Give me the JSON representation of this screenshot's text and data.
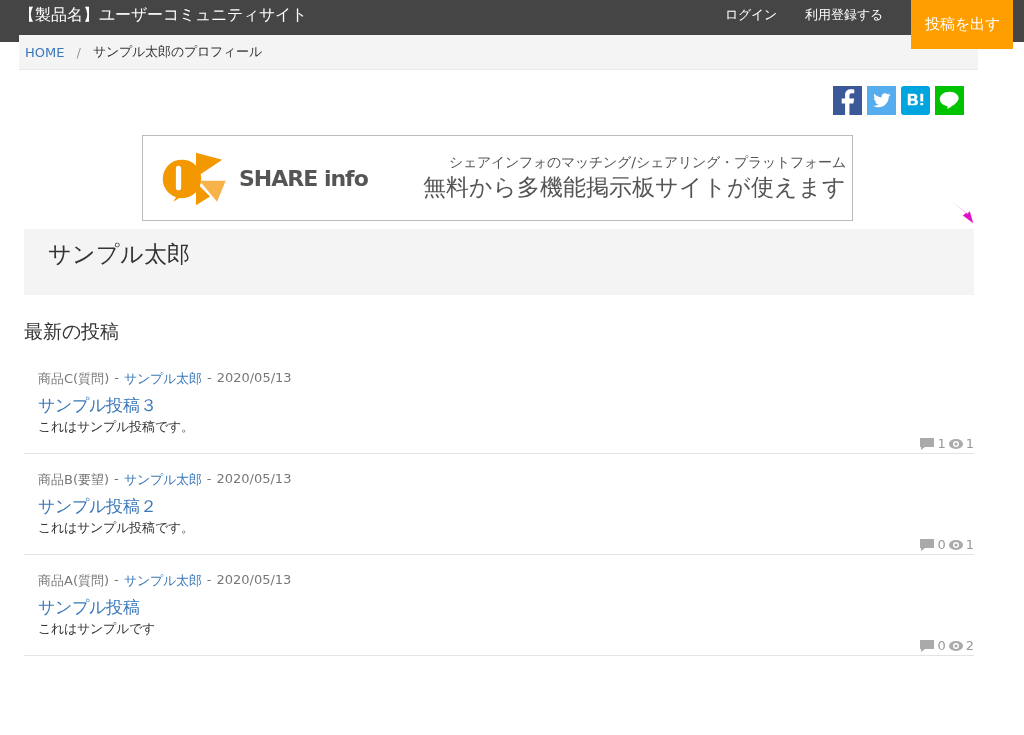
{
  "navbar": {
    "brand": "【製品名】ユーザーコミュニティサイト",
    "links": [
      "ログイン",
      "利用登録する"
    ],
    "post_button": "投稿を出す"
  },
  "breadcrumb": [
    {
      "label": "HOME",
      "kind": "link"
    },
    {
      "label": "/",
      "kind": "separator"
    },
    {
      "label": "サンプル太郎のプロフィール",
      "kind": "current"
    }
  ],
  "banner": {
    "logo_text": "SHARE info",
    "tagline": "シェアインフォのマッチング/シェアリング・プラットフォーム",
    "headline": "無料から多機能掲示板サイトが使えます"
  },
  "profile": {
    "name": "サンプル太郎"
  },
  "section_title": "最新の投稿",
  "posts": [
    {
      "meta": [
        {
          "text": "商品C(質問)",
          "kind": "category"
        },
        {
          "text": "-",
          "kind": "separator"
        },
        {
          "text": "サンプル太郎",
          "kind": "author"
        },
        {
          "text": "-",
          "kind": "separator"
        },
        {
          "text": "2020/05/13",
          "kind": "date"
        }
      ],
      "title": "サンプル投稿３",
      "body": "これはサンプル投稿です。",
      "comments": "1",
      "views": "1"
    },
    {
      "meta": [
        {
          "text": "商品B(要望)",
          "kind": "category"
        },
        {
          "text": "-",
          "kind": "separator"
        },
        {
          "text": "サンプル太郎",
          "kind": "author"
        },
        {
          "text": "-",
          "kind": "separator"
        },
        {
          "text": "2020/05/13",
          "kind": "date"
        }
      ],
      "title": "サンプル投稿２",
      "body": "これはサンプル投稿です。",
      "comments": "0",
      "views": "1"
    },
    {
      "meta": [
        {
          "text": "商品A(質問)",
          "kind": "category"
        },
        {
          "text": "-",
          "kind": "separator"
        },
        {
          "text": "サンプル太郎",
          "kind": "author"
        },
        {
          "text": "-",
          "kind": "separator"
        },
        {
          "text": "2020/05/13",
          "kind": "date"
        }
      ],
      "title": "サンプル投稿",
      "body": "これはサンプルです",
      "comments": "0",
      "views": "2"
    }
  ]
}
